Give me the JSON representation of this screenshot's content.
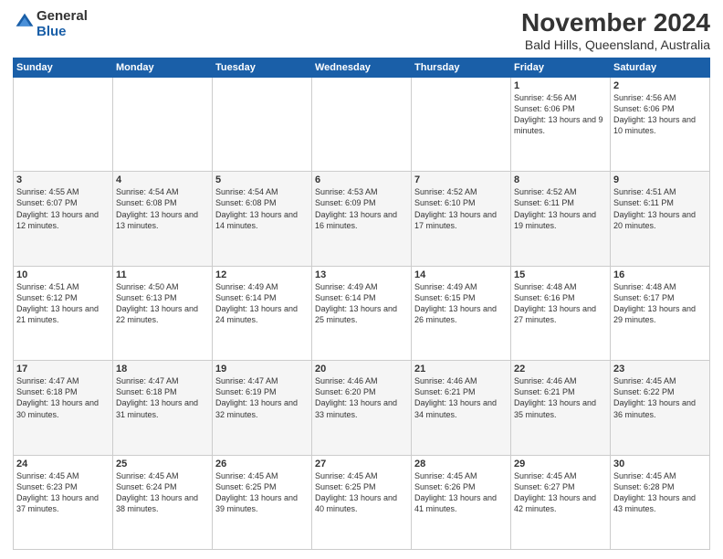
{
  "header": {
    "logo_general": "General",
    "logo_blue": "Blue",
    "title": "November 2024",
    "subtitle": "Bald Hills, Queensland, Australia"
  },
  "weekdays": [
    "Sunday",
    "Monday",
    "Tuesday",
    "Wednesday",
    "Thursday",
    "Friday",
    "Saturday"
  ],
  "weeks": [
    [
      {
        "day": "",
        "info": ""
      },
      {
        "day": "",
        "info": ""
      },
      {
        "day": "",
        "info": ""
      },
      {
        "day": "",
        "info": ""
      },
      {
        "day": "",
        "info": ""
      },
      {
        "day": "1",
        "info": "Sunrise: 4:56 AM\nSunset: 6:06 PM\nDaylight: 13 hours and 9 minutes."
      },
      {
        "day": "2",
        "info": "Sunrise: 4:56 AM\nSunset: 6:06 PM\nDaylight: 13 hours and 10 minutes."
      }
    ],
    [
      {
        "day": "3",
        "info": "Sunrise: 4:55 AM\nSunset: 6:07 PM\nDaylight: 13 hours and 12 minutes."
      },
      {
        "day": "4",
        "info": "Sunrise: 4:54 AM\nSunset: 6:08 PM\nDaylight: 13 hours and 13 minutes."
      },
      {
        "day": "5",
        "info": "Sunrise: 4:54 AM\nSunset: 6:08 PM\nDaylight: 13 hours and 14 minutes."
      },
      {
        "day": "6",
        "info": "Sunrise: 4:53 AM\nSunset: 6:09 PM\nDaylight: 13 hours and 16 minutes."
      },
      {
        "day": "7",
        "info": "Sunrise: 4:52 AM\nSunset: 6:10 PM\nDaylight: 13 hours and 17 minutes."
      },
      {
        "day": "8",
        "info": "Sunrise: 4:52 AM\nSunset: 6:11 PM\nDaylight: 13 hours and 19 minutes."
      },
      {
        "day": "9",
        "info": "Sunrise: 4:51 AM\nSunset: 6:11 PM\nDaylight: 13 hours and 20 minutes."
      }
    ],
    [
      {
        "day": "10",
        "info": "Sunrise: 4:51 AM\nSunset: 6:12 PM\nDaylight: 13 hours and 21 minutes."
      },
      {
        "day": "11",
        "info": "Sunrise: 4:50 AM\nSunset: 6:13 PM\nDaylight: 13 hours and 22 minutes."
      },
      {
        "day": "12",
        "info": "Sunrise: 4:49 AM\nSunset: 6:14 PM\nDaylight: 13 hours and 24 minutes."
      },
      {
        "day": "13",
        "info": "Sunrise: 4:49 AM\nSunset: 6:14 PM\nDaylight: 13 hours and 25 minutes."
      },
      {
        "day": "14",
        "info": "Sunrise: 4:49 AM\nSunset: 6:15 PM\nDaylight: 13 hours and 26 minutes."
      },
      {
        "day": "15",
        "info": "Sunrise: 4:48 AM\nSunset: 6:16 PM\nDaylight: 13 hours and 27 minutes."
      },
      {
        "day": "16",
        "info": "Sunrise: 4:48 AM\nSunset: 6:17 PM\nDaylight: 13 hours and 29 minutes."
      }
    ],
    [
      {
        "day": "17",
        "info": "Sunrise: 4:47 AM\nSunset: 6:18 PM\nDaylight: 13 hours and 30 minutes."
      },
      {
        "day": "18",
        "info": "Sunrise: 4:47 AM\nSunset: 6:18 PM\nDaylight: 13 hours and 31 minutes."
      },
      {
        "day": "19",
        "info": "Sunrise: 4:47 AM\nSunset: 6:19 PM\nDaylight: 13 hours and 32 minutes."
      },
      {
        "day": "20",
        "info": "Sunrise: 4:46 AM\nSunset: 6:20 PM\nDaylight: 13 hours and 33 minutes."
      },
      {
        "day": "21",
        "info": "Sunrise: 4:46 AM\nSunset: 6:21 PM\nDaylight: 13 hours and 34 minutes."
      },
      {
        "day": "22",
        "info": "Sunrise: 4:46 AM\nSunset: 6:21 PM\nDaylight: 13 hours and 35 minutes."
      },
      {
        "day": "23",
        "info": "Sunrise: 4:45 AM\nSunset: 6:22 PM\nDaylight: 13 hours and 36 minutes."
      }
    ],
    [
      {
        "day": "24",
        "info": "Sunrise: 4:45 AM\nSunset: 6:23 PM\nDaylight: 13 hours and 37 minutes."
      },
      {
        "day": "25",
        "info": "Sunrise: 4:45 AM\nSunset: 6:24 PM\nDaylight: 13 hours and 38 minutes."
      },
      {
        "day": "26",
        "info": "Sunrise: 4:45 AM\nSunset: 6:25 PM\nDaylight: 13 hours and 39 minutes."
      },
      {
        "day": "27",
        "info": "Sunrise: 4:45 AM\nSunset: 6:25 PM\nDaylight: 13 hours and 40 minutes."
      },
      {
        "day": "28",
        "info": "Sunrise: 4:45 AM\nSunset: 6:26 PM\nDaylight: 13 hours and 41 minutes."
      },
      {
        "day": "29",
        "info": "Sunrise: 4:45 AM\nSunset: 6:27 PM\nDaylight: 13 hours and 42 minutes."
      },
      {
        "day": "30",
        "info": "Sunrise: 4:45 AM\nSunset: 6:28 PM\nDaylight: 13 hours and 43 minutes."
      }
    ]
  ]
}
